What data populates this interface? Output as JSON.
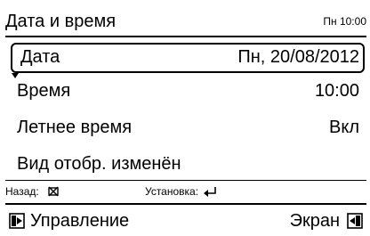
{
  "header": {
    "title": "Дата и время",
    "clock": "Пн 10:00"
  },
  "settings": {
    "rows": [
      {
        "label": "Дата",
        "value": "Пн, 20/08/2012",
        "selected": true
      },
      {
        "label": "Время",
        "value": "10:00"
      },
      {
        "label": "Летнее время",
        "value": "Вкл"
      },
      {
        "label": "Вид отобр. изменён",
        "value": ""
      }
    ]
  },
  "hints": {
    "back_label": "Назад:",
    "back_icon": "crossed-box-icon",
    "set_label": "Установка:",
    "set_icon": "enter-arrow-icon"
  },
  "bottom": {
    "left_label": "Управление",
    "left_icon": "nav-left-box-icon",
    "right_label": "Экран",
    "right_icon": "nav-right-box-icon"
  },
  "colors": {
    "background": "#ffffff",
    "foreground": "#000000"
  }
}
